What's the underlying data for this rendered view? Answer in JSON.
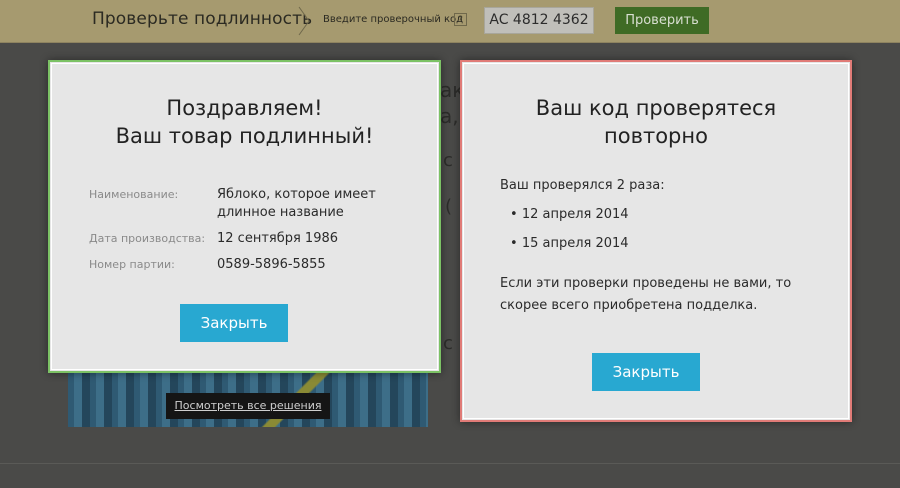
{
  "header": {
    "title": "Проверьте подлинность",
    "hint": "Введите проверочный код",
    "help": "?",
    "code_value": "AC 4812 4362",
    "check_label": "Проверить"
  },
  "background": {
    "frag1": "ак",
    "frag2": "а,",
    "frag3": "c",
    "frag4": "(",
    "frag5": "c",
    "view_all": "Посмотреть все решения"
  },
  "success_modal": {
    "title_line1": "Поздравляем!",
    "title_line2": "Ваш товар подлинный!",
    "rows": [
      {
        "label": "Наименование:",
        "value": "Яблоко, которое имеет длинное название"
      },
      {
        "label": "Дата производства:",
        "value": "12 сентября 1986"
      },
      {
        "label": "Номер партии:",
        "value": "0589-5896-5855"
      }
    ],
    "close_label": "Закрыть"
  },
  "warning_modal": {
    "title_line1": "Ваш код проверятеся",
    "title_line2": "повторно",
    "intro": "Ваш проверялся 2 раза:",
    "dates": [
      "12 апреля 2014",
      "15 апреля 2014"
    ],
    "note": "Если эти проверки проведены не вами, то скорее всего приобретена подделка.",
    "close_label": "Закрыть"
  },
  "colors": {
    "topbar": "#a69a6f",
    "success_border": "#7cc265",
    "warning_border": "#e07b77",
    "close_button": "#28a8d1",
    "check_button": "#3f6b25"
  }
}
